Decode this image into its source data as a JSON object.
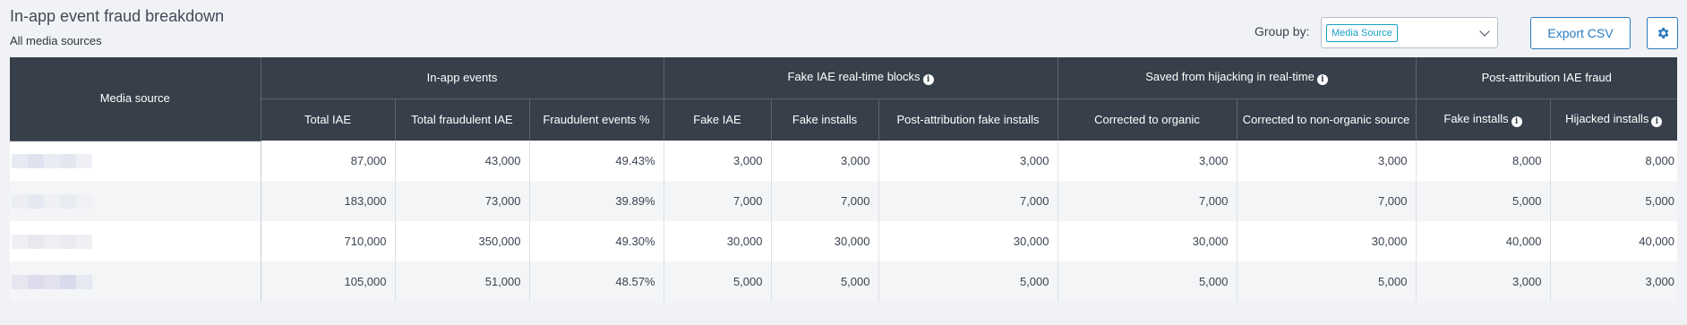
{
  "page": {
    "title": "In-app event fraud breakdown",
    "subtitle": "All media sources"
  },
  "toolbar": {
    "group_by_label": "Group by:",
    "group_by_value": "Media Source",
    "export_label": "Export CSV",
    "settings_icon": "gear-icon"
  },
  "table": {
    "headers": {
      "media_source": "Media source",
      "groups": [
        {
          "label": "In-app events",
          "info": false
        },
        {
          "label": "Fake IAE real-time blocks",
          "info": true
        },
        {
          "label": "Saved from hijacking in real-time",
          "info": true
        },
        {
          "label": "Post-attribution IAE fraud",
          "info": false
        }
      ],
      "columns": [
        {
          "label": "Total IAE",
          "info": false
        },
        {
          "label": "Total fraudulent IAE",
          "info": false
        },
        {
          "label": "Fraudulent events %",
          "info": false
        },
        {
          "label": "Fake IAE",
          "info": false
        },
        {
          "label": "Fake installs",
          "info": false
        },
        {
          "label": "Post-attribution fake installs",
          "info": false
        },
        {
          "label": "Corrected to organic",
          "info": false
        },
        {
          "label": "Corrected to non-organic source",
          "info": false
        },
        {
          "label": "Fake installs",
          "info": true
        },
        {
          "label": "Hijacked installs",
          "info": true
        }
      ]
    },
    "rows": [
      {
        "cells": [
          "87,000",
          "43,000",
          "49.43%",
          "3,000",
          "3,000",
          "3,000",
          "3,000",
          "3,000",
          "8,000",
          "8,000"
        ]
      },
      {
        "cells": [
          "183,000",
          "73,000",
          "39.89%",
          "7,000",
          "7,000",
          "7,000",
          "7,000",
          "7,000",
          "5,000",
          "5,000"
        ]
      },
      {
        "cells": [
          "710,000",
          "350,000",
          "49.30%",
          "30,000",
          "30,000",
          "30,000",
          "30,000",
          "30,000",
          "40,000",
          "40,000"
        ]
      },
      {
        "cells": [
          "105,000",
          "51,000",
          "48.57%",
          "5,000",
          "5,000",
          "5,000",
          "5,000",
          "5,000",
          "3,000",
          "3,000"
        ]
      }
    ]
  },
  "colors": {
    "header_bg": "#363f4a",
    "accent": "#2a7bbf",
    "chip": "#19a0c7"
  }
}
